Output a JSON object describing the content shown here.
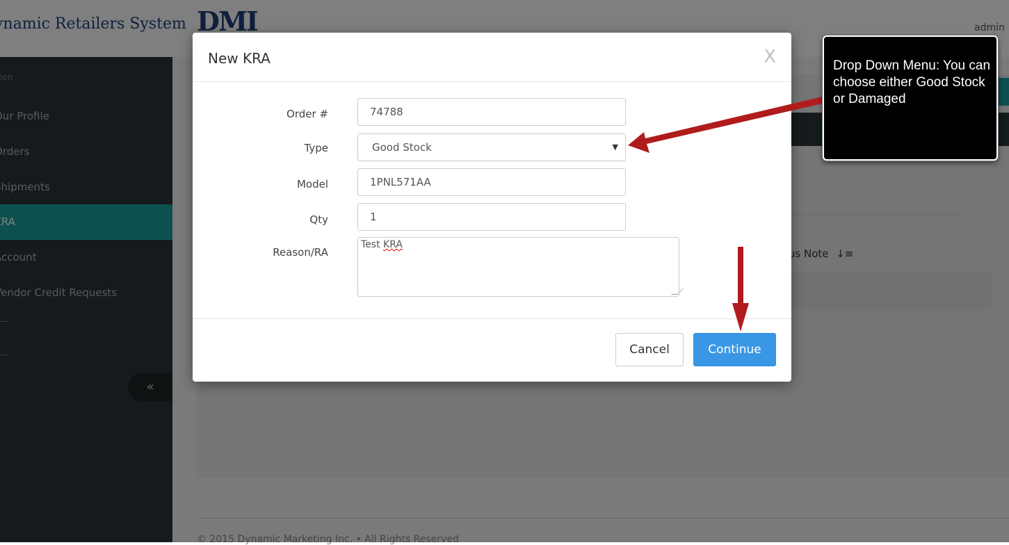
{
  "header": {
    "brand_text": "ynamic Retailers System",
    "brand_logo": "DMI",
    "user": "admin"
  },
  "sidebar": {
    "section_label": "ation",
    "items": [
      {
        "label": "Our Profile",
        "active": false
      },
      {
        "label": "Orders",
        "active": false
      },
      {
        "label": "Shipments",
        "active": false
      },
      {
        "label": "KRA",
        "active": true
      },
      {
        "label": "Account",
        "active": false
      },
      {
        "label": "Vendor Credit Requests",
        "active": false
      }
    ],
    "collapse_glyph": "«"
  },
  "content": {
    "status_note_header": "tus Note",
    "sort_glyph": "↓≡",
    "footer": "© 2015 Dynamic Marketing Inc. • All Rights Reserved"
  },
  "modal": {
    "title": "New KRA",
    "close_label": "X",
    "fields": {
      "order": {
        "label": "Order #",
        "value": "74788"
      },
      "type": {
        "label": "Type",
        "value": "Good Stock"
      },
      "model": {
        "label": "Model",
        "value": "1PNL571AA"
      },
      "qty": {
        "label": "Qty",
        "value": "1"
      },
      "reason": {
        "label": "Reason/RA",
        "value_prefix": "Test ",
        "value_flagged": "KRA"
      }
    },
    "cancel_label": "Cancel",
    "continue_label": "Continue"
  },
  "callout": {
    "text": "Drop Down Menu: You can choose either Good Stock or Damaged"
  },
  "colors": {
    "accent": "#18a3a0",
    "sidebar_bg": "#2b3438",
    "primary_button": "#3a97e6",
    "annotation_arrow": "#b01c1c"
  }
}
